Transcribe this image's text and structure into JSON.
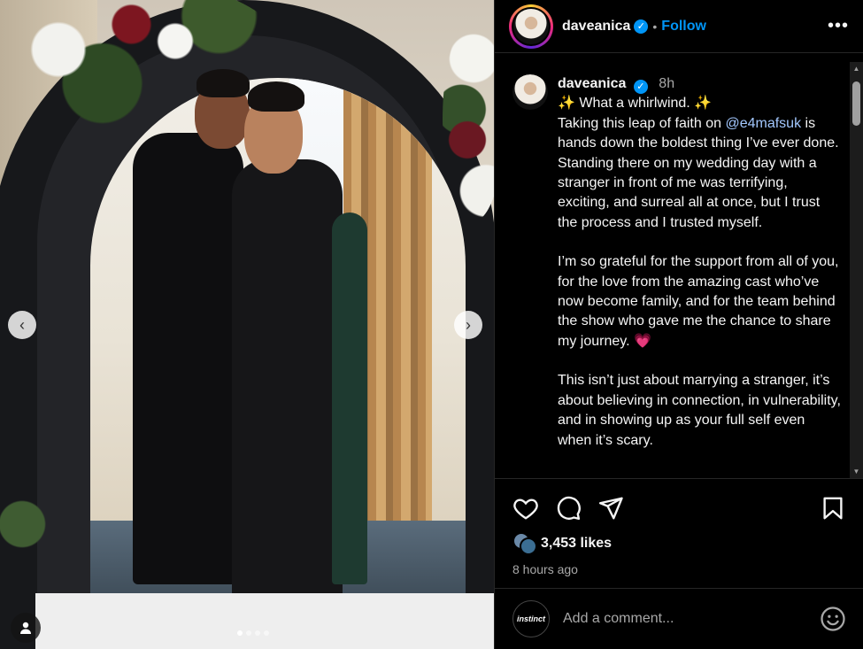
{
  "post": {
    "username": "daveanica",
    "verified_glyph": "✓",
    "follow_label": "Follow",
    "dot": "•",
    "more_label": "•••",
    "slide_count": 4,
    "active_slide": 1
  },
  "caption": {
    "username": "daveanica",
    "time": "8h",
    "line1": "✨ What a whirlwind. ✨",
    "intro_before_mention": "Taking this leap of faith on ",
    "mention": "@e4mafsuk",
    "intro_after_mention": " is hands down the boldest thing I’ve ever done. Standing there on my wedding day with a stranger in front of me was terrifying, exciting, and surreal all at once, but I trust the process and I trusted myself.",
    "para2": "I’m so grateful for the support from all of you, for the love from the amazing cast who’ve now become family, and for the team behind the show who gave me the chance to share my journey. 💗",
    "para3": "This isn’t just about marrying a stranger, it’s about believing in connection, in vulnerability, and in showing up as your full self even when it’s scary."
  },
  "stats": {
    "likes": "3,453 likes",
    "posted": "8 hours ago"
  },
  "comment": {
    "avatar_text": "instinct",
    "placeholder": "Add a comment..."
  },
  "icons": {
    "prev": "‹",
    "next": "›",
    "scroll_up": "▲",
    "scroll_down": "▼"
  },
  "colors": {
    "accent": "#0095f6",
    "background": "#000000",
    "border": "#262626",
    "muted_text": "#a8a8a8"
  }
}
